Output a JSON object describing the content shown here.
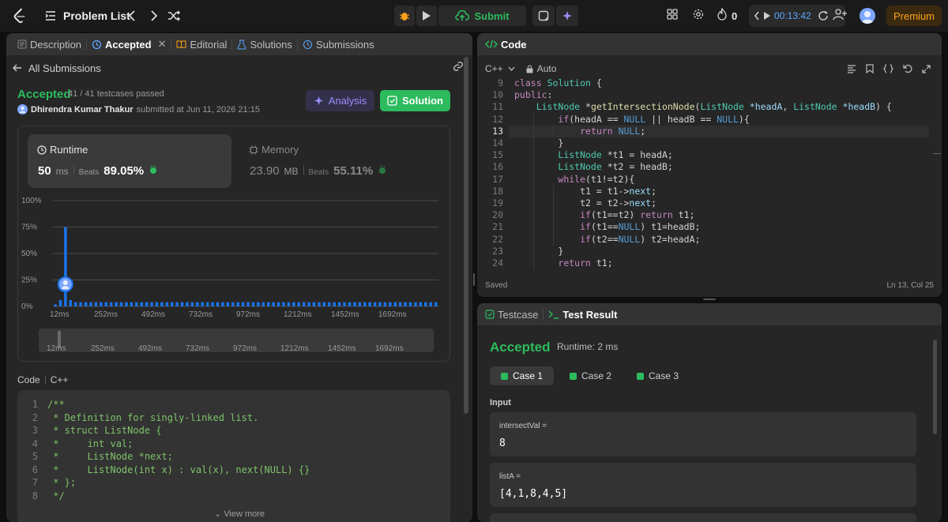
{
  "topbar": {
    "problem_list": "Problem List",
    "submit": "Submit",
    "streak_count": "0",
    "timer": "00:13:42",
    "premium": "Premium",
    "colors": {
      "accent_green": "#2cbb5d",
      "premium": "#ffa116",
      "timer": "#5aa9ff"
    }
  },
  "left": {
    "tabs": [
      {
        "label": "Description",
        "icon": "description-icon"
      },
      {
        "label": "Accepted",
        "icon": "history-icon"
      },
      {
        "label": "Editorial",
        "icon": "book-icon"
      },
      {
        "label": "Solutions",
        "icon": "flask-icon"
      },
      {
        "label": "Submissions",
        "icon": "clock-icon"
      }
    ],
    "all_submissions": "All Submissions",
    "status": "Accepted",
    "testcases": "41 / 41 testcases passed",
    "author": "Dhirendra Kumar Thakur",
    "submitted": "submitted at Jun 11, 2026 21:15",
    "analysis": "Analysis",
    "solution": "Solution",
    "runtime": {
      "title": "Runtime",
      "value": "50",
      "unit": "ms",
      "beats_label": "Beats",
      "beats": "89.05%"
    },
    "memory": {
      "title": "Memory",
      "value": "23.90",
      "unit": "MB",
      "beats_label": "Beats",
      "beats": "55.11%"
    },
    "code_label": "Code",
    "lang": "C++",
    "code_lines": [
      "/**",
      " * Definition for singly-linked list.",
      " * struct ListNode {",
      " *     int val;",
      " *     ListNode *next;",
      " *     ListNode(int x) : val(x), next(NULL) {}",
      " * };",
      " */"
    ],
    "view_more": "View more"
  },
  "chart_data": {
    "type": "bar",
    "title": "",
    "ylabel": "",
    "xlabel": "",
    "y_ticks": [
      "100%",
      "75%",
      "50%",
      "25%",
      "0%"
    ],
    "ylim": [
      0,
      100
    ],
    "x_ticks": [
      "12ms",
      "252ms",
      "492ms",
      "732ms",
      "972ms",
      "1212ms",
      "1452ms",
      "1692ms"
    ],
    "range_ticks": [
      "12ms",
      "252ms",
      "492ms",
      "732ms",
      "972ms",
      "1212ms",
      "1452ms",
      "1692ms"
    ],
    "highlight_index": 2,
    "values": [
      2,
      6,
      75,
      6,
      4,
      4,
      4,
      4,
      4,
      4,
      4,
      4,
      4,
      4,
      4,
      4,
      4,
      4,
      4,
      4,
      4,
      4,
      4,
      4,
      4,
      4,
      4,
      4,
      4,
      4,
      4,
      4,
      4,
      4,
      4,
      4,
      4,
      4,
      4,
      4,
      4,
      4,
      4,
      4,
      4,
      4,
      4,
      4,
      4,
      4,
      4,
      4,
      4,
      4,
      4,
      4,
      4,
      4,
      4,
      4,
      4,
      4,
      4,
      4,
      4,
      4,
      4,
      4,
      4,
      4,
      4,
      4,
      4,
      4,
      4,
      4
    ],
    "bar_color": "#1a73e8"
  },
  "editor": {
    "title": "Code",
    "lang": "C++",
    "mode": "Auto",
    "current_line": 13,
    "lines": [
      {
        "n": "9",
        "t": "class Solution {"
      },
      {
        "n": "10",
        "t": "public:"
      },
      {
        "n": "11",
        "t": "    ListNode *getIntersectionNode(ListNode *headA, ListNode *headB) {"
      },
      {
        "n": "12",
        "t": "        if(headA == NULL || headB == NULL){"
      },
      {
        "n": "13",
        "t": "            return NULL;"
      },
      {
        "n": "14",
        "t": "        }"
      },
      {
        "n": "15",
        "t": "        ListNode *t1 = headA;"
      },
      {
        "n": "16",
        "t": "        ListNode *t2 = headB;"
      },
      {
        "n": "17",
        "t": "        while(t1!=t2){"
      },
      {
        "n": "18",
        "t": "            t1 = t1->next;"
      },
      {
        "n": "19",
        "t": "            t2 = t2->next;"
      },
      {
        "n": "20",
        "t": "            if(t1==t2) return t1;"
      },
      {
        "n": "21",
        "t": "            if(t1==NULL) t1=headB;"
      },
      {
        "n": "22",
        "t": "            if(t2==NULL) t2=headA;"
      },
      {
        "n": "23",
        "t": "        }"
      },
      {
        "n": "24",
        "t": "        return t1;"
      }
    ],
    "saved": "Saved",
    "cursor": "Ln 13, Col 25"
  },
  "test": {
    "tab_testcase": "Testcase",
    "tab_result": "Test Result",
    "status": "Accepted",
    "runtime": "Runtime: 2 ms",
    "cases": [
      "Case 1",
      "Case 2",
      "Case 3"
    ],
    "input_label": "Input",
    "inputs": [
      {
        "name": "intersectVal =",
        "value": "8"
      },
      {
        "name": "listA =",
        "value": "[4,1,8,4,5]"
      }
    ]
  }
}
